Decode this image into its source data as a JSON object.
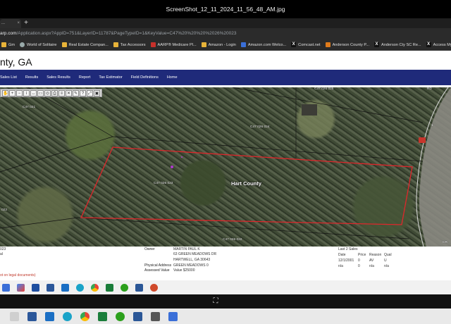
{
  "viewer": {
    "title": "ScreenShot_12_11_2024_11_56_48_AM.jpg"
  },
  "browser": {
    "tab_label": "...",
    "new_tab": "+",
    "url_domain": "arp.com",
    "url_path": "/Application.aspx?AppID=751&LayerID=11787&PageTypeID=1&KeyValue=C47%20%20%20%2026%20023",
    "bookmarks": [
      {
        "label": "Gm",
        "icon": "folder"
      },
      {
        "label": "World of Solitaire",
        "icon": "grey"
      },
      {
        "label": "Real Estate Compan...",
        "icon": "folder"
      },
      {
        "label": "Tax Accessors",
        "icon": "folder"
      },
      {
        "label": "AARP® Medicare Pl...",
        "icon": "red"
      },
      {
        "label": "Amazon - Login",
        "icon": "folder"
      },
      {
        "label": "Amazon.com Welco...",
        "icon": "blue"
      },
      {
        "label": "Comcast.net",
        "icon": "x"
      },
      {
        "label": "Anderson County P...",
        "icon": "orange"
      },
      {
        "label": "Anderson Cty SC Re...",
        "icon": "x"
      },
      {
        "label": "Access My Account",
        "icon": "x"
      }
    ]
  },
  "site": {
    "county_title": "nty, GA",
    "nav": [
      "Sales List",
      "Results",
      "Sales Results",
      "Report",
      "Tax Estimator",
      "Field Definitions",
      "Home"
    ]
  },
  "map": {
    "county_label": "Hart County",
    "parcel_labels": [
      {
        "text": "C47  026 025"
      },
      {
        "text": "C47  021"
      },
      {
        "text": "C47  026 024"
      },
      {
        "text": "C47  026 023"
      },
      {
        "text": "C47  026 022"
      },
      {
        "text": "022"
      },
      {
        "text": "CR"
      },
      {
        "text": "1"
      },
      {
        "text": "RD"
      }
    ]
  },
  "info": {
    "left1": "023",
    "left2": "al",
    "left_note": "ot on legal documents)",
    "owner_label": "Owner",
    "owner_name": "MARTIN PAUL K",
    "owner_addr1": "63 GREEN MEADOWS DR",
    "owner_addr2": "HARTWELL, GA 30643",
    "phys_label": "Physical Address",
    "phys_value": "GREEN MEADOWS 0",
    "assessed_label": "Assessed Value",
    "assessed_value": "Value $25000",
    "sales_title": "Last 2 Sales",
    "sales_headers": [
      "Date",
      "Price",
      "Reason",
      "Qual"
    ],
    "sales_rows": [
      [
        "12/1/2001",
        "0",
        "AV",
        "U"
      ],
      [
        "n/a",
        "0",
        "n/a",
        "n/a"
      ]
    ]
  },
  "colors": {
    "nav_bg": "#1f2a7a",
    "parcel_outline": "#e0262b"
  }
}
